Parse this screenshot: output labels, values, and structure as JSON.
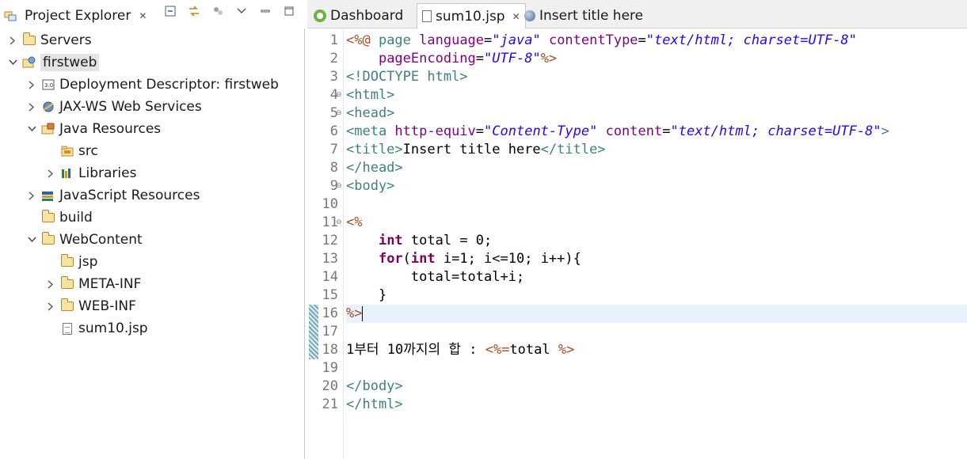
{
  "left_panel": {
    "tab_title": "Project Explorer",
    "tree": [
      {
        "label": "Servers",
        "depth": 0,
        "expanded": false,
        "icon": "folder-icon",
        "selected": false
      },
      {
        "label": "firstweb",
        "depth": 0,
        "expanded": true,
        "icon": "web-project-icon",
        "selected": true
      },
      {
        "label": "Deployment Descriptor: firstweb",
        "depth": 1,
        "expanded": false,
        "icon": "deployment-descriptor-icon",
        "selected": false
      },
      {
        "label": "JAX-WS Web Services",
        "depth": 1,
        "expanded": false,
        "icon": "webservice-icon",
        "selected": false
      },
      {
        "label": "Java Resources",
        "depth": 1,
        "expanded": true,
        "icon": "java-resources-icon",
        "selected": false
      },
      {
        "label": "src",
        "depth": 2,
        "expanded": null,
        "icon": "source-folder-icon",
        "selected": false
      },
      {
        "label": "Libraries",
        "depth": 2,
        "expanded": false,
        "icon": "libraries-icon",
        "selected": false
      },
      {
        "label": "JavaScript Resources",
        "depth": 1,
        "expanded": false,
        "icon": "javascript-resources-icon",
        "selected": false
      },
      {
        "label": "build",
        "depth": 1,
        "expanded": null,
        "icon": "folder-icon",
        "selected": false
      },
      {
        "label": "WebContent",
        "depth": 1,
        "expanded": true,
        "icon": "folder-icon",
        "selected": false
      },
      {
        "label": "jsp",
        "depth": 2,
        "expanded": null,
        "icon": "folder-icon",
        "selected": false
      },
      {
        "label": "META-INF",
        "depth": 2,
        "expanded": false,
        "icon": "folder-icon",
        "selected": false
      },
      {
        "label": "WEB-INF",
        "depth": 2,
        "expanded": false,
        "icon": "folder-icon",
        "selected": false
      },
      {
        "label": "sum10.jsp",
        "depth": 2,
        "expanded": null,
        "icon": "jsp-file-icon",
        "selected": false
      }
    ]
  },
  "editor": {
    "tabs": [
      {
        "label": "Dashboard",
        "icon": "spring-icon",
        "active": false
      },
      {
        "label": "sum10.jsp",
        "icon": "jsp-file-icon",
        "active": true,
        "closable": true
      },
      {
        "label": "Insert title here",
        "icon": "globe-icon",
        "active": false
      }
    ],
    "current_line": 16,
    "lines": [
      {
        "n": "1",
        "tokens": [
          [
            "tk-delim",
            "<%@ "
          ],
          [
            "tk-dir",
            "page "
          ],
          [
            "tk-attr",
            "language"
          ],
          [
            "tk-sym",
            "="
          ],
          [
            "tk-val",
            "\"java\""
          ],
          [
            "tk-sym",
            " "
          ],
          [
            "tk-attr",
            "contentType"
          ],
          [
            "tk-sym",
            "="
          ],
          [
            "tk-val",
            "\"text/html; charset=UTF-8\""
          ]
        ]
      },
      {
        "n": "2",
        "tokens": [
          [
            "tk-sym",
            "    "
          ],
          [
            "tk-attr",
            "pageEncoding"
          ],
          [
            "tk-sym",
            "="
          ],
          [
            "tk-val",
            "\"UTF-8\""
          ],
          [
            "tk-delim",
            "%>"
          ]
        ]
      },
      {
        "n": "3",
        "tokens": [
          [
            "tk-tag",
            "<!DOCTYPE html>"
          ]
        ]
      },
      {
        "n": "4",
        "fold": true,
        "tokens": [
          [
            "tk-tag",
            "<html>"
          ]
        ]
      },
      {
        "n": "5",
        "fold": true,
        "tokens": [
          [
            "tk-tag",
            "<head>"
          ]
        ]
      },
      {
        "n": "6",
        "tokens": [
          [
            "tk-tag",
            "<meta "
          ],
          [
            "tk-attr",
            "http-equiv"
          ],
          [
            "tk-sym",
            "="
          ],
          [
            "tk-val",
            "\"Content-Type\""
          ],
          [
            "tk-sym",
            " "
          ],
          [
            "tk-attr",
            "content"
          ],
          [
            "tk-sym",
            "="
          ],
          [
            "tk-val",
            "\"text/html; charset=UTF-8\""
          ],
          [
            "tk-tag",
            ">"
          ]
        ]
      },
      {
        "n": "7",
        "tokens": [
          [
            "tk-tag",
            "<title>"
          ],
          [
            "tk-txt",
            "Insert title here"
          ],
          [
            "tk-tag",
            "</title>"
          ]
        ]
      },
      {
        "n": "8",
        "tokens": [
          [
            "tk-tag",
            "</head>"
          ]
        ]
      },
      {
        "n": "9",
        "fold": true,
        "tokens": [
          [
            "tk-tag",
            "<body>"
          ]
        ]
      },
      {
        "n": "10",
        "tokens": []
      },
      {
        "n": "11",
        "fold": true,
        "tokens": [
          [
            "tk-delim",
            "<%"
          ]
        ]
      },
      {
        "n": "12",
        "tokens": [
          [
            "tk-sym",
            "    "
          ],
          [
            "tk-kw",
            "int"
          ],
          [
            "tk-txt",
            " total = 0;"
          ]
        ]
      },
      {
        "n": "13",
        "tokens": [
          [
            "tk-sym",
            "    "
          ],
          [
            "tk-kw",
            "for"
          ],
          [
            "tk-txt",
            "("
          ],
          [
            "tk-kw",
            "int"
          ],
          [
            "tk-txt",
            " i=1; i<=10; i++){"
          ]
        ]
      },
      {
        "n": "14",
        "tokens": [
          [
            "tk-txt",
            "        total=total+i;"
          ]
        ]
      },
      {
        "n": "15",
        "tokens": [
          [
            "tk-txt",
            "    }"
          ]
        ]
      },
      {
        "n": "16",
        "marker": true,
        "tokens": [
          [
            "tk-delim",
            "%>"
          ]
        ]
      },
      {
        "n": "17",
        "marker": true,
        "tokens": []
      },
      {
        "n": "18",
        "marker": true,
        "tokens": [
          [
            "tk-txt",
            "1부터 10까지의 합 : "
          ],
          [
            "tk-delim",
            "<%="
          ],
          [
            "tk-txt",
            "total "
          ],
          [
            "tk-delim",
            "%>"
          ]
        ]
      },
      {
        "n": "19",
        "tokens": []
      },
      {
        "n": "20",
        "tokens": [
          [
            "tk-tag",
            "</body>"
          ]
        ]
      },
      {
        "n": "21",
        "tokens": [
          [
            "tk-tag",
            "</html>"
          ]
        ]
      }
    ]
  }
}
